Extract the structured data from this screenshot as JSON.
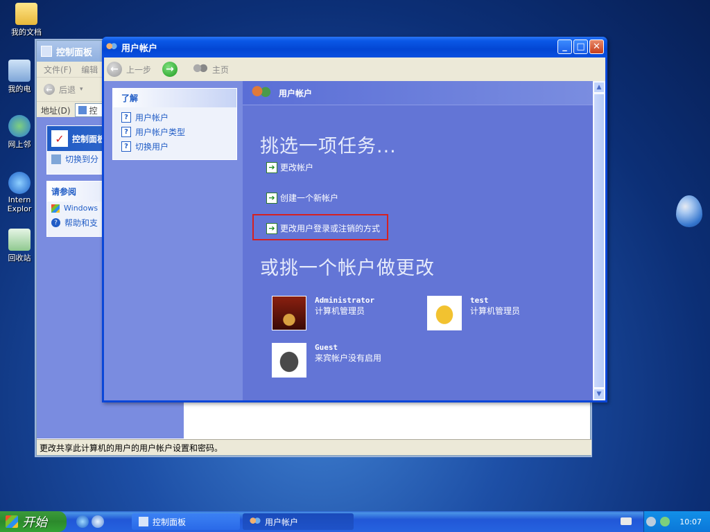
{
  "desktop": {
    "icons": [
      {
        "label": "我的文档"
      },
      {
        "label": "我的电"
      },
      {
        "label": "网上邻"
      },
      {
        "label": "Intern Explor"
      },
      {
        "label": "回收站"
      }
    ]
  },
  "control_panel": {
    "title": "控制面板",
    "menu": [
      "文件(F)",
      "编辑"
    ],
    "back": "后退",
    "address_label": "地址(D)",
    "address_value": "控",
    "panel_title": "控制面板",
    "switch_view": "切换到分",
    "see_also_title": "请参阅",
    "see_also_items": [
      "Windows",
      "帮助和支"
    ],
    "status_text": "更改共享此计算机的用户的用户帐户设置和密码。"
  },
  "user_accounts": {
    "title": "用户帐户",
    "toolbar": {
      "back": "上一步",
      "home": "主页"
    },
    "sidebar": {
      "title": "了解",
      "items": [
        "用户帐户",
        "用户帐户类型",
        "切换用户"
      ]
    },
    "header_title": "用户帐户",
    "pick_task": "挑选一项任务...",
    "tasks": [
      "更改帐户",
      "创建一个新帐户",
      "更改用户登录或注销的方式"
    ],
    "pick_account": "或挑一个帐户做更改",
    "accounts": [
      {
        "name": "Administrator",
        "role": "计算机管理员",
        "color": "#7a1a10"
      },
      {
        "name": "test",
        "role": "计算机管理员",
        "color": "#f2c230"
      },
      {
        "name": "Guest",
        "role": "来宾帐户没有启用",
        "color": "#4a4a4a"
      }
    ]
  },
  "taskbar": {
    "start_label": "开始",
    "buttons": [
      "控制面板",
      "用户帐户"
    ],
    "clock": "10:07"
  }
}
